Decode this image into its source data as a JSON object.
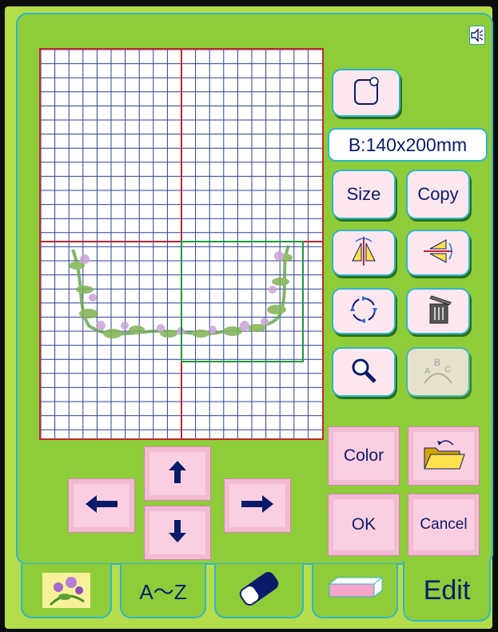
{
  "colors": {
    "background": "#b4dd4a",
    "panel": "#8ecc3a",
    "accent_border": "#2fb6c9",
    "button_fill": "#fde7ef",
    "arrow_button_fill": "#f4b9d3",
    "grid_line": "#2c3f9c",
    "hoop_line": "#c1272d",
    "selection_box": "#1e9a3a",
    "text": "#0b1b6b"
  },
  "hoop_info": "B:140x200mm",
  "buttons": {
    "size": "Size",
    "copy": "Copy",
    "color": "Color",
    "ok": "OK",
    "cancel": "Cancel"
  },
  "tabs": {
    "alphabet": "A～Z",
    "edit": "Edit"
  },
  "icons": {
    "speaker": "speaker-icon",
    "hoop": "hoop-select-icon",
    "mirror": "mirror-horizontal-icon",
    "flip": "mirror-vertical-icon",
    "rotate": "rotate-icon",
    "delete": "trash-icon",
    "zoom": "magnifier-icon",
    "arc_text": "arc-text-icon",
    "open_folder": "open-folder-icon",
    "up": "arrow-up-icon",
    "down": "arrow-down-icon",
    "left": "arrow-left-icon",
    "right": "arrow-right-icon",
    "design_tab": "flower-design-icon",
    "eraser_tab": "eraser-icon",
    "hoop_tab": "hoop-frame-icon"
  }
}
